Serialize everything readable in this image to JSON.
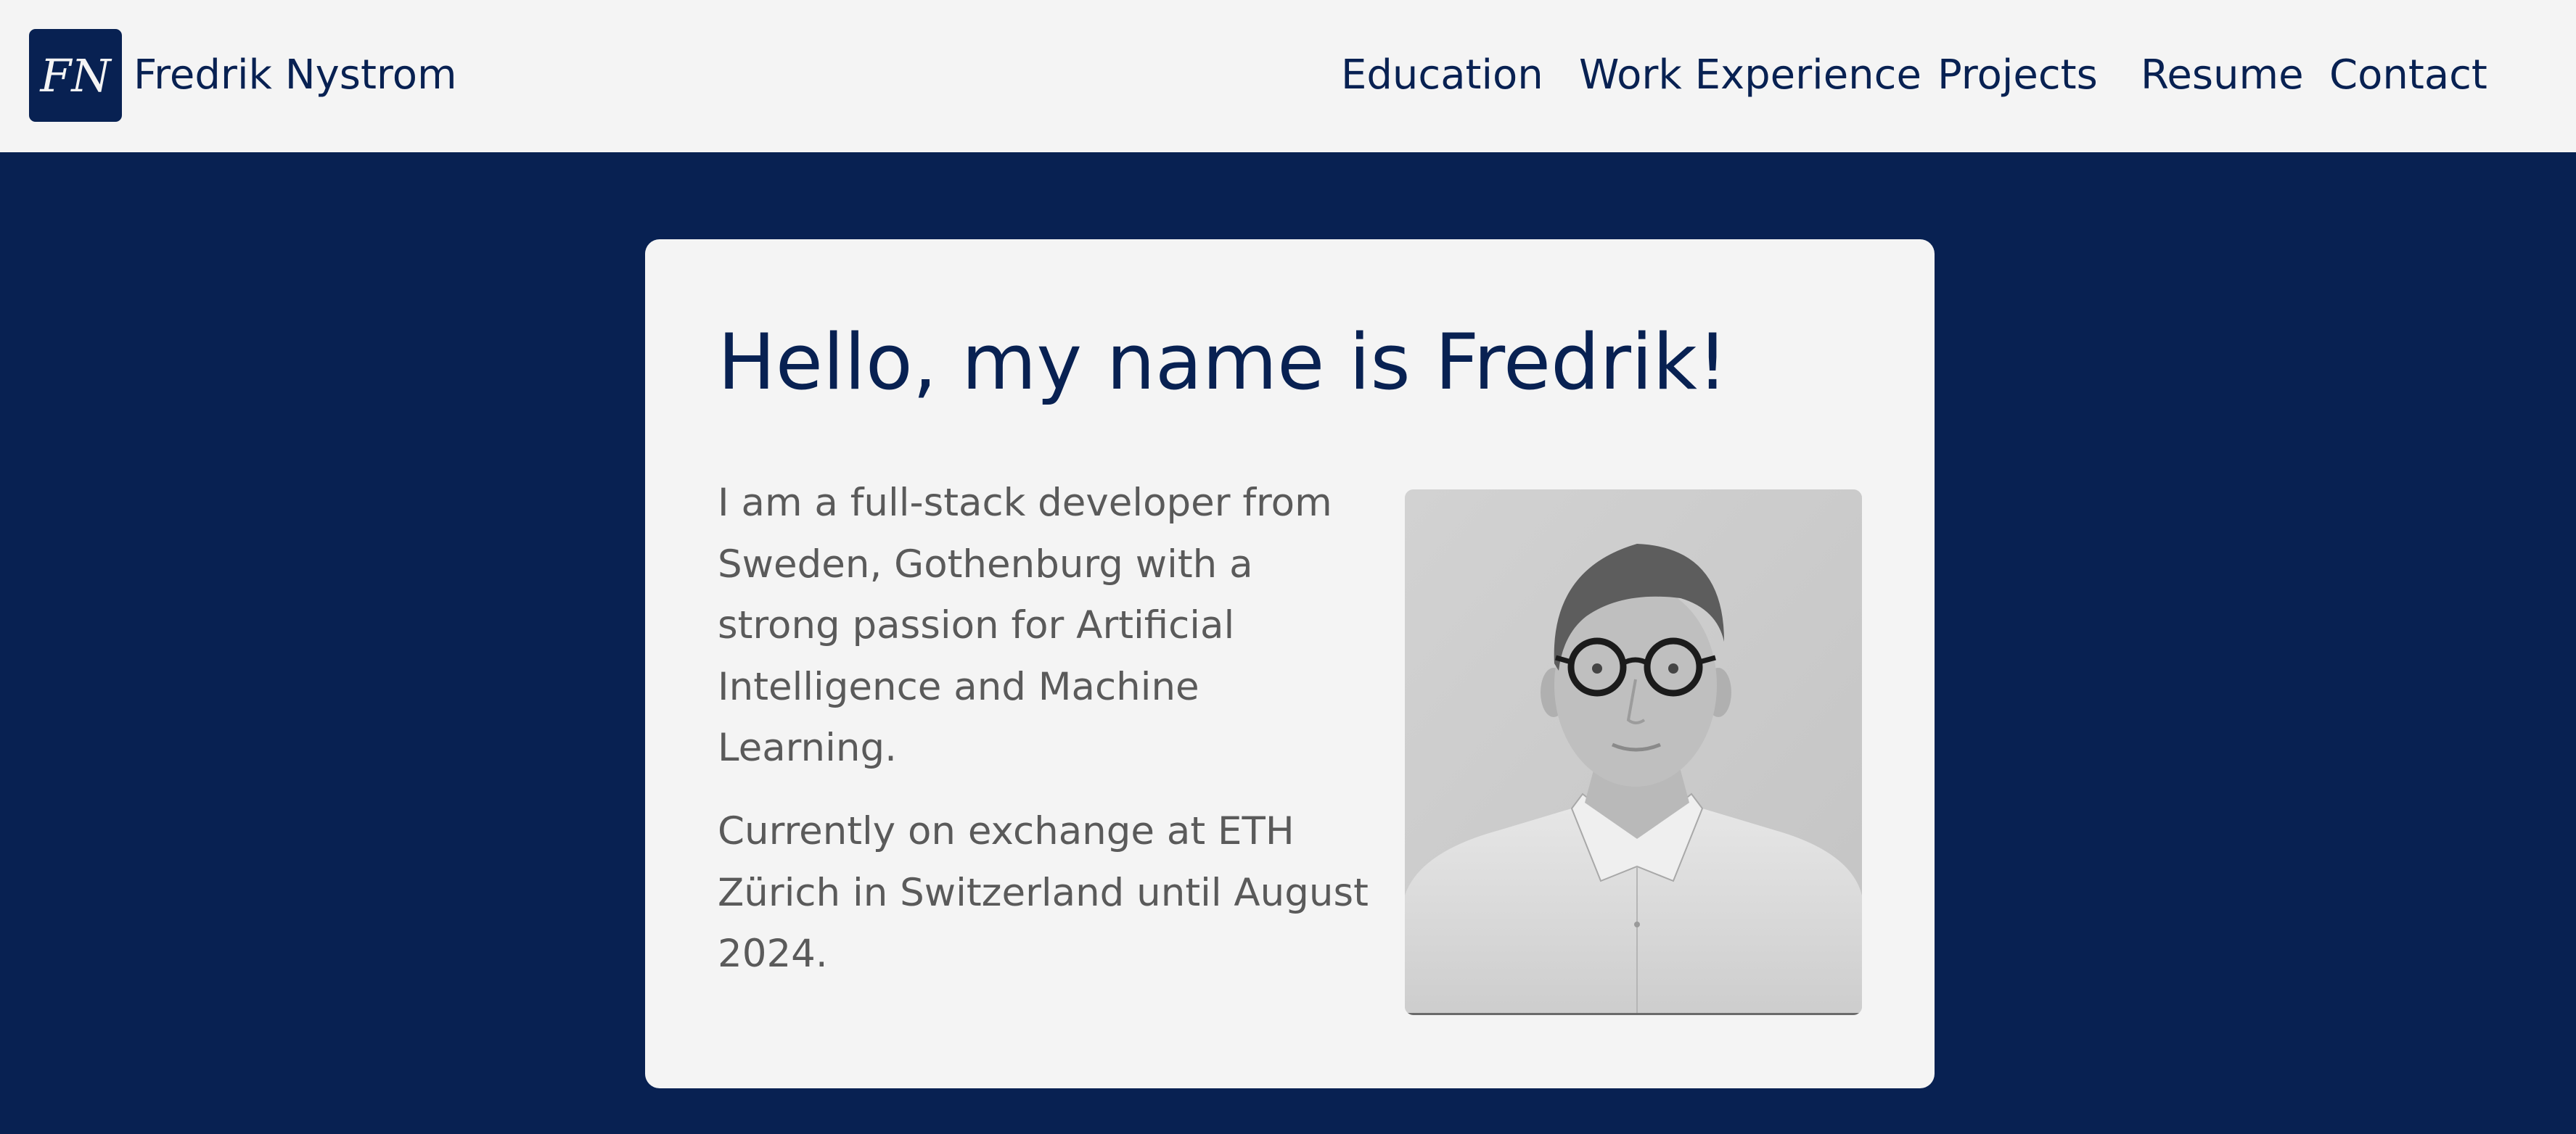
{
  "brand": {
    "logo_text": "FN",
    "name": "Fredrik Nystrom"
  },
  "nav": {
    "education": "Education",
    "work": "Work Experience",
    "projects": "Projects",
    "resume": "Resume",
    "contact": "Contact"
  },
  "hero": {
    "title": "Hello, my name is Fredrik!",
    "paragraph_1": "I am a full-stack developer from Sweden, Gothenburg with a strong passion for Artificial Intelligence and Machine Learning.",
    "paragraph_2": "Currently on exchange at ETH Zürich in Switzerland until August 2024."
  },
  "colors": {
    "navy": "#082152",
    "card_background": "#f4f4f4",
    "body_text": "#5a5a5a"
  }
}
